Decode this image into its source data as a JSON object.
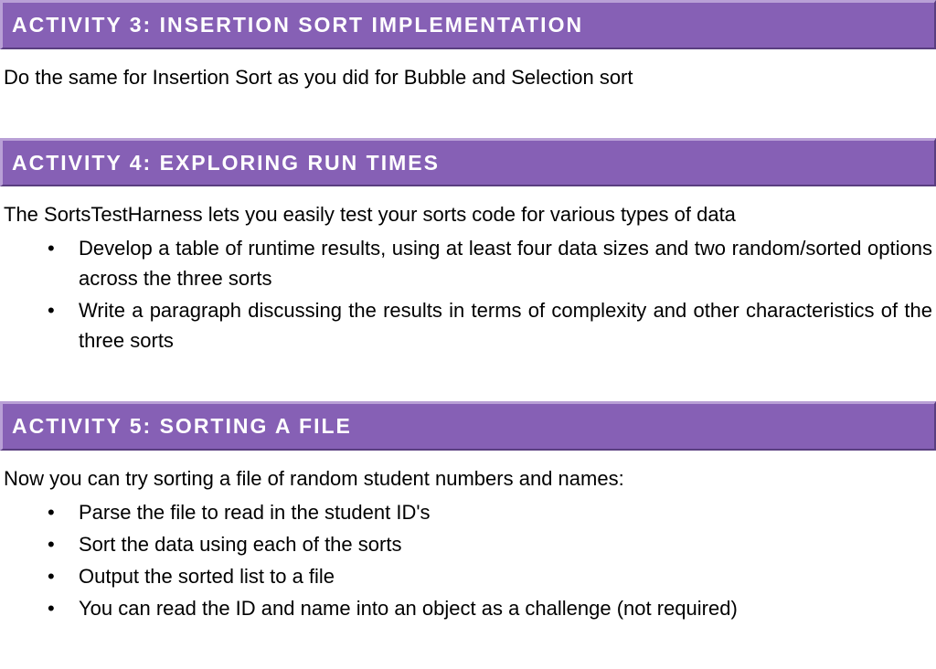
{
  "activities": [
    {
      "heading": "ACTIVITY 3: INSERTION SORT IMPLEMENTATION",
      "intro": "Do the same for Insertion Sort as you did for Bubble and Selection sort",
      "bullets": []
    },
    {
      "heading": "ACTIVITY 4: EXPLORING RUN TIMES",
      "intro": "The SortsTestHarness lets you easily test your sorts code for various types of data",
      "bullets": [
        "Develop a table of runtime results, using at least four data sizes and two random/sorted options across the three sorts",
        "Write a paragraph discussing the results in terms of complexity and other characteristics of the three sorts"
      ],
      "justify_bullets": true
    },
    {
      "heading": "ACTIVITY 5: SORTING A FILE",
      "intro": "Now you can try sorting a file of random student numbers and names:",
      "bullets": [
        "Parse the file to read in the student ID's",
        "Sort the data using each of the sorts",
        "Output the sorted list to a file",
        "You can read the ID and name into an object as a challenge (not required)"
      ],
      "justify_bullets": false
    }
  ]
}
